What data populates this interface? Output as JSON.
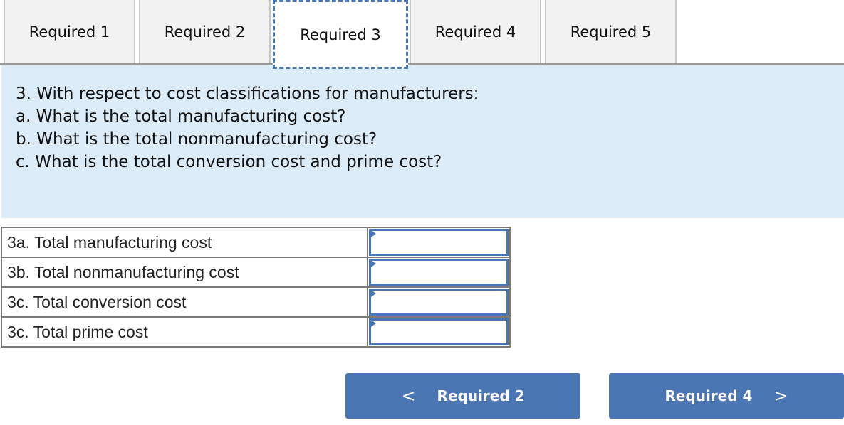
{
  "tabs": [
    {
      "label": "Required 1",
      "active": false
    },
    {
      "label": "Required 2",
      "active": false
    },
    {
      "label": "Required 3",
      "active": true
    },
    {
      "label": "Required 4",
      "active": false
    },
    {
      "label": "Required 5",
      "active": false
    }
  ],
  "question": {
    "lines": [
      "3. With respect to cost classifications for manufacturers:",
      "a. What is the total manufacturing cost?",
      "b. What is the total nonmanufacturing cost?",
      "c. What is the total conversion cost and prime cost?"
    ]
  },
  "answers": [
    {
      "label": "3a. Total manufacturing cost",
      "value": ""
    },
    {
      "label": "3b. Total nonmanufacturing cost",
      "value": ""
    },
    {
      "label": "3c. Total conversion cost",
      "value": ""
    },
    {
      "label": "3c. Total prime cost",
      "value": ""
    }
  ],
  "nav": {
    "prev": {
      "label": "Required 2",
      "icon": "chevron-left-icon",
      "glyph": "<"
    },
    "next": {
      "label": "Required 4",
      "icon": "chevron-right-icon",
      "glyph": ">"
    }
  },
  "colors": {
    "accent": "#4a76b4",
    "question_bg": "#dcebf8",
    "tab_bg": "#f2f2f2"
  }
}
